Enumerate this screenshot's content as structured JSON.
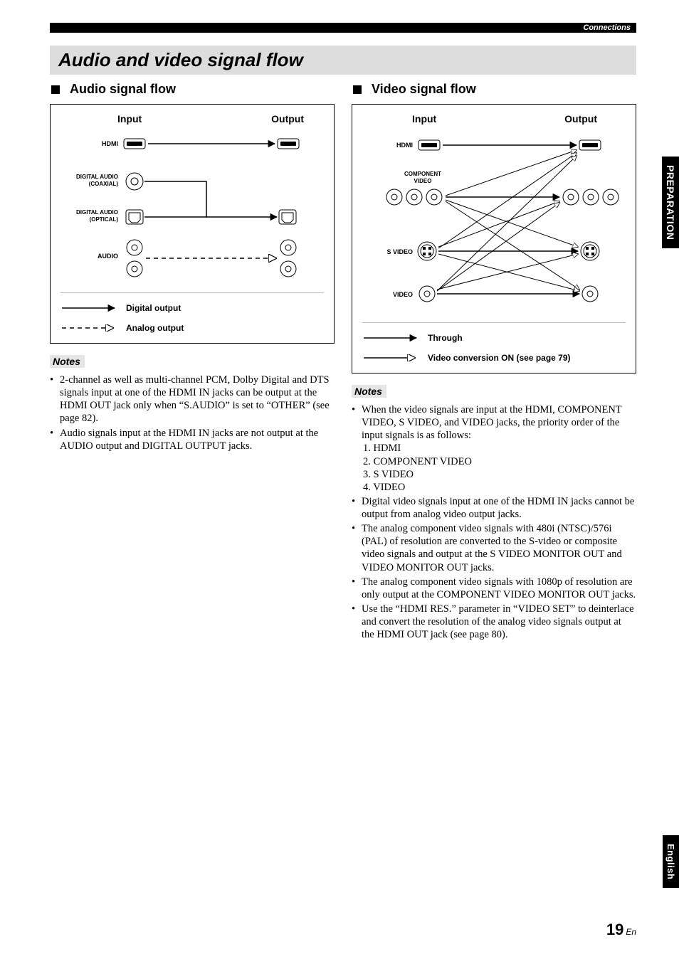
{
  "header": {
    "section_label": "Connections"
  },
  "title": "Audio and video signal flow",
  "audio": {
    "heading": "Audio signal flow",
    "cols": {
      "input": "Input",
      "output": "Output"
    },
    "rows": {
      "hdmi": "HDMI",
      "coax": "DIGITAL AUDIO (COAXIAL)",
      "opt": "DIGITAL AUDIO (OPTICAL)",
      "analog": "AUDIO"
    },
    "legend": {
      "digital": "Digital output",
      "analog": "Analog output"
    },
    "notes_label": "Notes",
    "notes": [
      "2-channel as well as multi-channel PCM, Dolby Digital and DTS signals input at one of the HDMI IN jacks can be output at the HDMI OUT jack only when “S.AUDIO” is set to “OTHER” (see page 82).",
      "Audio signals input at the HDMI IN jacks are not output at the AUDIO output and DIGITAL OUTPUT jacks."
    ]
  },
  "video": {
    "heading": "Video signal flow",
    "cols": {
      "input": "Input",
      "output": "Output"
    },
    "rows": {
      "hdmi": "HDMI",
      "component": "COMPONENT VIDEO",
      "svideo": "S VIDEO",
      "video": "VIDEO"
    },
    "legend": {
      "through": "Through",
      "convert": "Video conversion ON (see page 79)"
    },
    "notes_label": "Notes",
    "notes": [
      "When the video signals are input at the HDMI, COMPONENT VIDEO, S VIDEO, and VIDEO jacks, the priority order of the input signals is as follows:",
      "Digital video signals input at one of the HDMI IN jacks cannot be output from analog video output jacks.",
      "The analog component video signals with 480i (NTSC)/576i (PAL) of resolution are converted to the S-video or composite video signals and output at the S VIDEO MONITOR OUT and VIDEO MONITOR OUT jacks.",
      "The analog component video signals with 1080p of resolution are only output at the COMPONENT VIDEO MONITOR OUT jacks.",
      "Use the “HDMI RES.” parameter in “VIDEO SET” to deinterlace and convert the resolution of the analog video signals output at the HDMI OUT jack (see page 80)."
    ],
    "priority": [
      "1. HDMI",
      "2. COMPONENT VIDEO",
      "3. S VIDEO",
      "4. VIDEO"
    ]
  },
  "side_tabs": {
    "preparation": "PREPARATION",
    "english": "English"
  },
  "footer": {
    "page": "19",
    "suffix": "En"
  }
}
